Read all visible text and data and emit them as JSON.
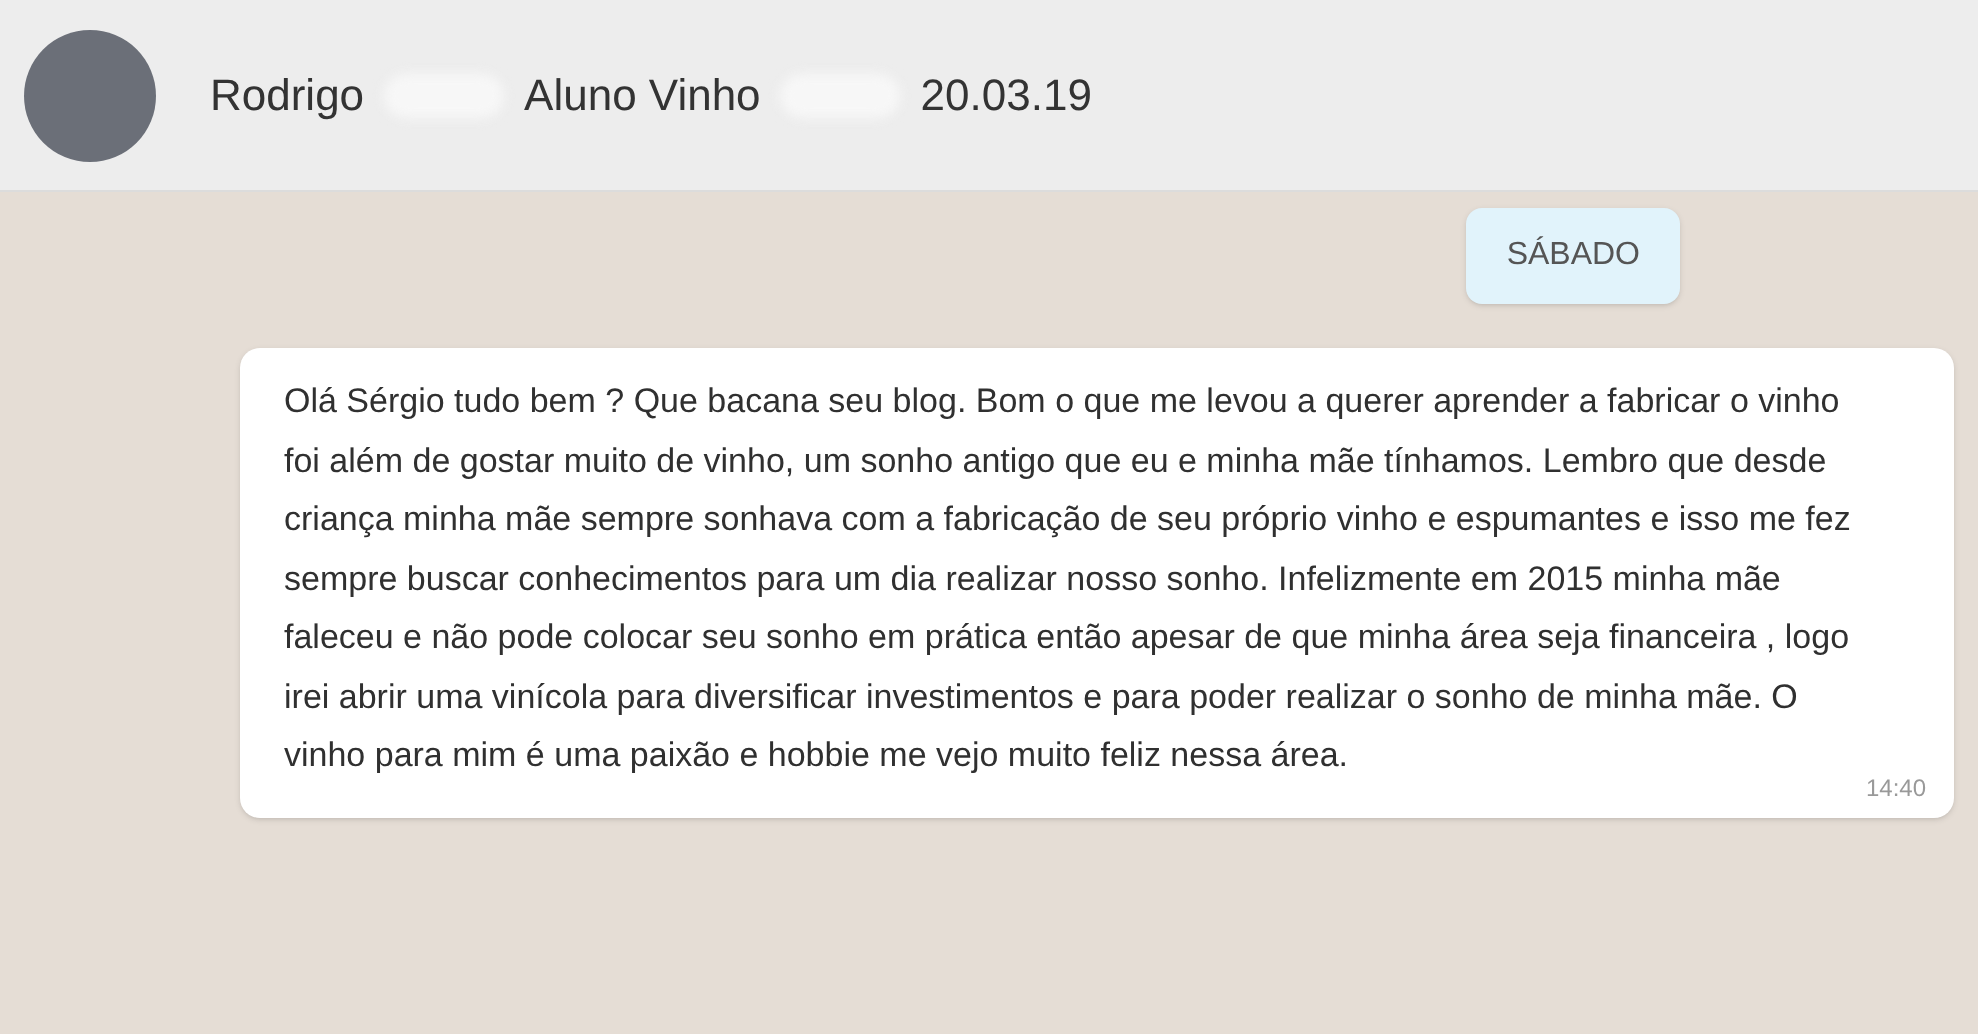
{
  "header": {
    "title_parts": [
      "Rodrigo",
      "Aluno Vinho",
      "20.03.19"
    ]
  },
  "date_chip": "SÁBADO",
  "messages": [
    {
      "text": "Olá Sérgio tudo bem ? Que bacana seu blog. Bom o que me levou a querer aprender a fabricar o vinho foi além de gostar muito de vinho, um sonho antigo que eu e minha mãe tínhamos. Lembro que desde criança minha mãe sempre sonhava com a fabricação de seu próprio vinho e espumantes e isso me fez sempre buscar conhecimentos para um dia realizar nosso sonho. Infelizmente em 2015 minha mãe faleceu e não pode colocar seu sonho em prática então apesar de que minha área seja financeira , logo irei abrir uma vinícola para diversificar investimentos e para poder realizar o sonho de minha mãe. O vinho para mim é uma paixão e hobbie me vejo muito feliz nessa área.",
      "time": "14:40"
    }
  ]
}
